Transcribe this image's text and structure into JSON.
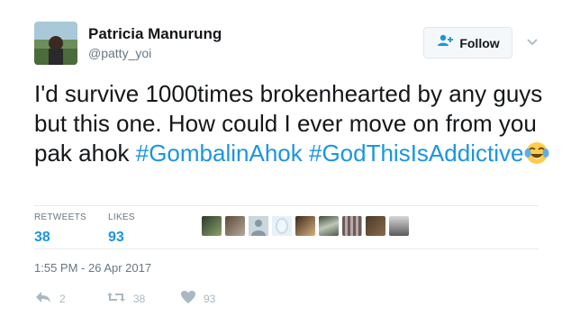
{
  "author": {
    "name": "Patricia Manurung",
    "handle": "@patty_yoi"
  },
  "follow_label": "Follow",
  "tweet": {
    "text_plain": "I'd survive 1000times brokenhearted by any guys but this one. How could I ever move on from you pak ahok ",
    "hashtag1": "#GombalinAhok",
    "hashtag2": "#GodThisIsAddictive",
    "emoji": "face-with-tears-of-joy"
  },
  "stats": {
    "retweets_label": "RETWEETS",
    "retweets": "38",
    "likes_label": "LIKES",
    "likes": "93"
  },
  "liker_avatar_count": 9,
  "timestamp": "1:55 PM - 26 Apr 2017",
  "actions": {
    "reply_count": "2",
    "retweet_count": "38",
    "like_count": "93"
  },
  "colors": {
    "link": "#1b95e0",
    "text": "#14171a",
    "muted": "#657786",
    "action_icon": "#aab8c2"
  }
}
